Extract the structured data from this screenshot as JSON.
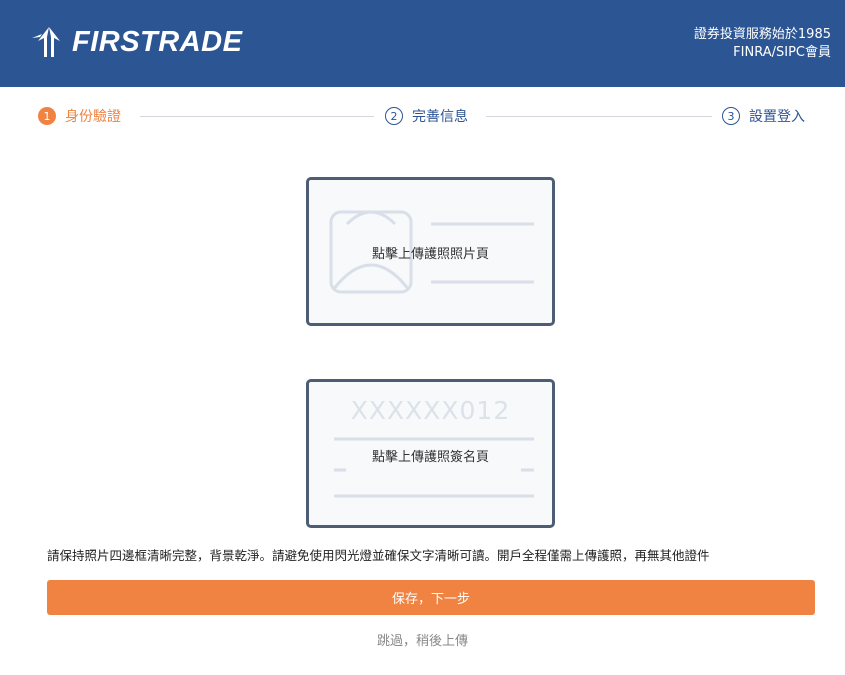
{
  "header": {
    "logo_text": "FIRSTRADE",
    "tagline_line1": "證券投資服務始於1985",
    "tagline_line2": "FINRA/SIPC會員",
    "background_color": "#2c5594"
  },
  "steps": [
    {
      "number": "1",
      "label": "身份驗證",
      "state": "active"
    },
    {
      "number": "2",
      "label": "完善信息",
      "state": "inactive"
    },
    {
      "number": "3",
      "label": "設置登入",
      "state": "inactive"
    }
  ],
  "upload_cards": {
    "photo_page": {
      "label": "點擊上傳護照照片頁",
      "icon": "passport-photo-page-icon"
    },
    "signature_page": {
      "label": "點擊上傳護照簽名頁",
      "serial": "XXXXXX012",
      "icon": "passport-signature-page-icon"
    }
  },
  "note": "請保持照片四邊框清晰完整，背景乾淨。請避免使用閃光燈並確保文字清晰可讀。開戶全程僅需上傳護照，再無其他證件",
  "actions": {
    "primary_label": "保存，下一步",
    "skip_label": "跳過，稍後上傳"
  },
  "colors": {
    "accent": "#f08341",
    "brand": "#2c5594"
  }
}
